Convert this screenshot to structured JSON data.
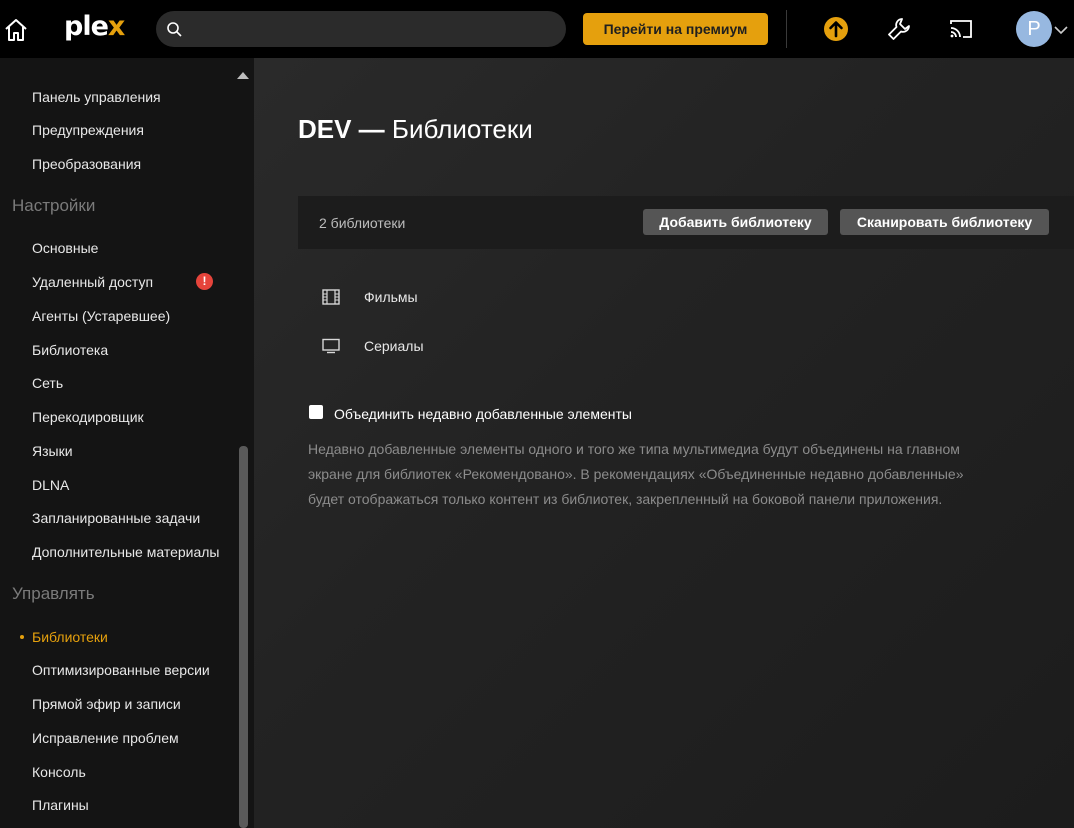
{
  "topbar": {
    "logo_text": "plex",
    "search_placeholder": "",
    "premium_label": "Перейти на премиум",
    "avatar_letter": "P",
    "icons": [
      "home-icon",
      "search-icon",
      "activity-upload-icon",
      "wrench-icon",
      "cast-icon",
      "chevron-down-icon"
    ],
    "accent": "#e5a00d"
  },
  "sidebar": {
    "top_items": [
      {
        "label": "Панель управления"
      },
      {
        "label": "Предупреждения"
      },
      {
        "label": "Преобразования"
      }
    ],
    "settings_heading": "Настройки",
    "settings_items": [
      {
        "label": "Основные"
      },
      {
        "label": "Удаленный доступ",
        "warning": "!"
      },
      {
        "label": "Агенты (Устаревшее)"
      },
      {
        "label": "Библиотека"
      },
      {
        "label": "Сеть"
      },
      {
        "label": "Перекодировщик"
      },
      {
        "label": "Языки"
      },
      {
        "label": "DLNA"
      },
      {
        "label": "Запланированные задачи"
      },
      {
        "label": "Дополнительные материалы"
      }
    ],
    "manage_heading": "Управлять",
    "manage_items": [
      {
        "label": "Библиотеки",
        "active": true
      },
      {
        "label": "Оптимизированные версии"
      },
      {
        "label": "Прямой эфир и записи"
      },
      {
        "label": "Исправление проблем"
      },
      {
        "label": "Консоль"
      },
      {
        "label": "Плагины"
      }
    ],
    "warning_color": "#e5443b"
  },
  "main": {
    "title_server": "DEV —",
    "title_page": "Библиотеки",
    "library_count": "2 библиотеки",
    "add_library_label": "Добавить библиотеку",
    "scan_library_label": "Сканировать библиотеку",
    "libraries": [
      {
        "name": "Фильмы",
        "icon": "film-icon"
      },
      {
        "name": "Сериалы",
        "icon": "tv-icon"
      }
    ],
    "merge_checkbox_label": "Объединить недавно добавленные элементы",
    "merge_checkbox_checked": false,
    "merge_description": "Недавно добавленные элементы одного и того же типа мультимедиа будут объединены на главном экране для библиотек «Рекомендовано». В рекомендациях «Объединенные недавно добавленные» будет отображаться только контент из библиотек, закрепленный на боковой панели приложения."
  }
}
